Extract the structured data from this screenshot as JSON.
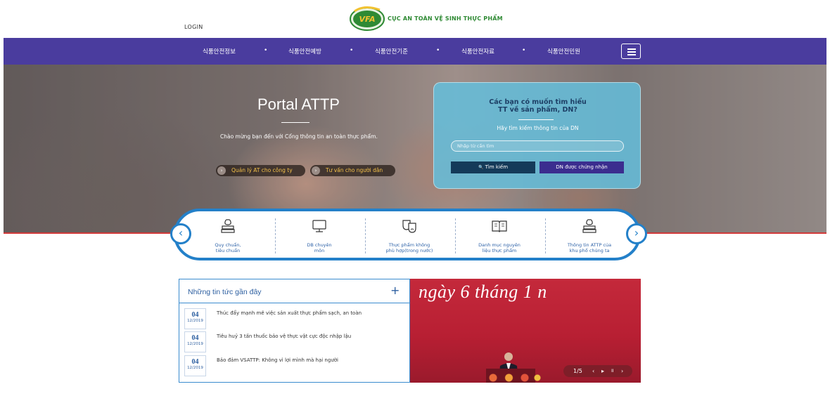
{
  "header": {
    "login_label": "LOGIN",
    "logo_text": "VFA",
    "brand_name": "CỤC AN TOÀN VỆ SINH THỰC PHẨM"
  },
  "nav": {
    "items": [
      "식품안전정보",
      "식품안전예방",
      "식품안전기준",
      "식품안전자료",
      "식품안전민원"
    ],
    "separator": "•",
    "menu_icon": "hamburger-icon"
  },
  "hero": {
    "title": "Portal ATTP",
    "subtitle": "Chào mừng bạn đến với Cổng thông tin an toàn thực phẩm.",
    "buttons": [
      "Quản lý AT cho công ty",
      "Tư vấn cho người dân"
    ],
    "button_icon": "›"
  },
  "search_box": {
    "title_line1": "Các bạn có muốn tìm hiểu",
    "title_line2": "TT về sản phẩm, DN?",
    "hint": "Hãy tìm kiếm thông tin của DN",
    "placeholder": "Nhập từ cần tìm",
    "search_button": "Tìm kiếm",
    "search_icon": "🔍",
    "certified_button": "DN được chứng nhận"
  },
  "categories": {
    "prev_icon": "‹",
    "next_icon": "›",
    "items": [
      {
        "line1": "Quy chuẩn,",
        "line2": "tiêu chuẩn",
        "icon": "books-apple-icon"
      },
      {
        "line1": "DB chuyên",
        "line2": "môn",
        "icon": "monitor-icon"
      },
      {
        "line1": "Thực phẩm không",
        "line2": "phù hợp(trong nước)",
        "icon": "theater-masks-icon"
      },
      {
        "line1": "Danh mục nguyên",
        "line2": "liệu thực phẩm",
        "icon": "open-book-icon"
      },
      {
        "line1": "Thông tin ATTP của",
        "line2": "khu phố chúng ta",
        "icon": "books-apple-icon"
      }
    ]
  },
  "news": {
    "title": "Những tin tức gần đây",
    "more_icon": "+",
    "items": [
      {
        "day": "04",
        "month": "12/2019",
        "text": "Thúc đẩy mạnh mẽ việc sản xuất thực phẩm sạch, an toàn"
      },
      {
        "day": "04",
        "month": "12/2019",
        "text": "Tiêu huỷ 3 tấn thuốc bảo vệ thực vật cực độc nhập lậu"
      },
      {
        "day": "04",
        "month": "12/2019",
        "text": "Bảo đảm VSATTP: Không vì lợi mình mà hại người"
      }
    ]
  },
  "banner": {
    "text": "ngày 6 tháng 1 n",
    "counter": "1/5",
    "prev": "‹",
    "play": "▸",
    "pause": "II",
    "next": "›"
  },
  "colors": {
    "nav_bg": "#4a3c9e",
    "accent_blue": "#2380c9",
    "brand_green": "#2f8a34",
    "hero_red_line": "#d13a3a",
    "pill_text": "#f5c24a"
  }
}
